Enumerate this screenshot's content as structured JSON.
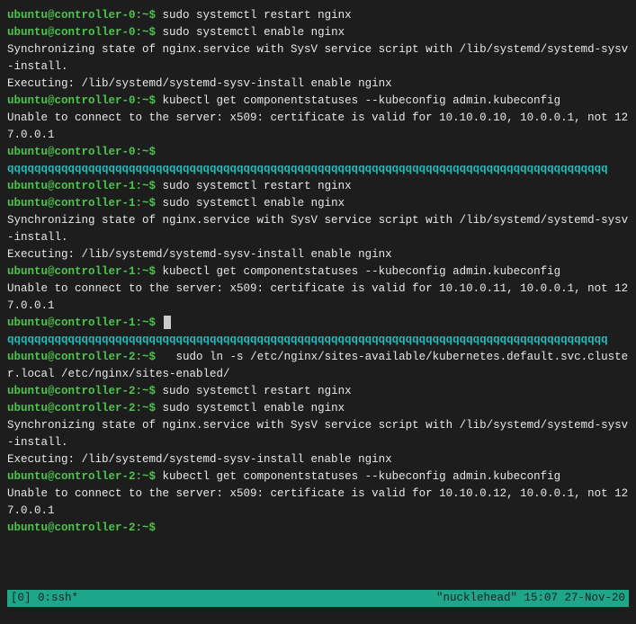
{
  "panes": [
    {
      "host": "controller-0",
      "ip": "10.10.0.10",
      "prompt": "ubuntu@controller-0:~$",
      "divider": "qqqqqqqqqqqqqqqqqqqqqqqqqqqqqqqqqqqqqqqqqqqqqqqqqqqqqqqqqqqqqqqqqqqqqqqqqqqqqqqqqqqqqqqqq",
      "lines": [
        {
          "type": "cmd",
          "text": "sudo systemctl restart nginx"
        },
        {
          "type": "cmd",
          "text": "sudo systemctl enable nginx"
        },
        {
          "type": "out",
          "text": "Synchronizing state of nginx.service with SysV service script with /lib/systemd/systemd-sysv-install."
        },
        {
          "type": "out",
          "text": "Executing: /lib/systemd/systemd-sysv-install enable nginx"
        },
        {
          "type": "cmd",
          "text": "kubectl get componentstatuses --kubeconfig admin.kubeconfig"
        },
        {
          "type": "out",
          "text": "Unable to connect to the server: x509: certificate is valid for 10.10.0.10, 10.0.0.1, not 127.0.0.1"
        },
        {
          "type": "cmd",
          "text": ""
        }
      ]
    },
    {
      "host": "controller-1",
      "ip": "10.10.0.11",
      "prompt": "ubuntu@controller-1:~$",
      "divider": "qqqqqqqqqqqqqqqqqqqqqqqqqqqqqqqqqqqqqqqqqqqqqqqqqqqqqqqqqqqqqqqqqqqqqqqqqqqqqqqqqqqqqqqqq",
      "has_cursor": true,
      "lines": [
        {
          "type": "cmd",
          "text": "sudo systemctl restart nginx"
        },
        {
          "type": "cmd",
          "text": "sudo systemctl enable nginx"
        },
        {
          "type": "out",
          "text": "Synchronizing state of nginx.service with SysV service script with /lib/systemd/systemd-sysv-install."
        },
        {
          "type": "out",
          "text": "Executing: /lib/systemd/systemd-sysv-install enable nginx"
        },
        {
          "type": "cmd",
          "text": "kubectl get componentstatuses --kubeconfig admin.kubeconfig"
        },
        {
          "type": "out",
          "text": "Unable to connect to the server: x509: certificate is valid for 10.10.0.11, 10.0.0.1, not 127.0.0.1"
        },
        {
          "type": "cmd",
          "text": "",
          "cursor": true
        }
      ]
    },
    {
      "host": "controller-2",
      "ip": "10.10.0.12",
      "prompt": "ubuntu@controller-2:~$",
      "lines": [
        {
          "type": "cmd",
          "text": "  sudo ln -s /etc/nginx/sites-available/kubernetes.default.svc.cluster.local /etc/nginx/sites-enabled/"
        },
        {
          "type": "cmd",
          "text": "sudo systemctl restart nginx"
        },
        {
          "type": "cmd",
          "text": "sudo systemctl enable nginx"
        },
        {
          "type": "out",
          "text": "Synchronizing state of nginx.service with SysV service script with /lib/systemd/systemd-sysv-install."
        },
        {
          "type": "out",
          "text": "Executing: /lib/systemd/systemd-sysv-install enable nginx"
        },
        {
          "type": "cmd",
          "text": "kubectl get componentstatuses --kubeconfig admin.kubeconfig"
        },
        {
          "type": "out",
          "text": "Unable to connect to the server: x509: certificate is valid for 10.10.0.12, 10.0.0.1, not 127.0.0.1"
        },
        {
          "type": "cmd",
          "text": ""
        }
      ]
    }
  ],
  "statusbar": {
    "left": "[0] 0:ssh*",
    "middle": "\"nucklehead\"",
    "right": "15:07 27-Nov-20"
  }
}
